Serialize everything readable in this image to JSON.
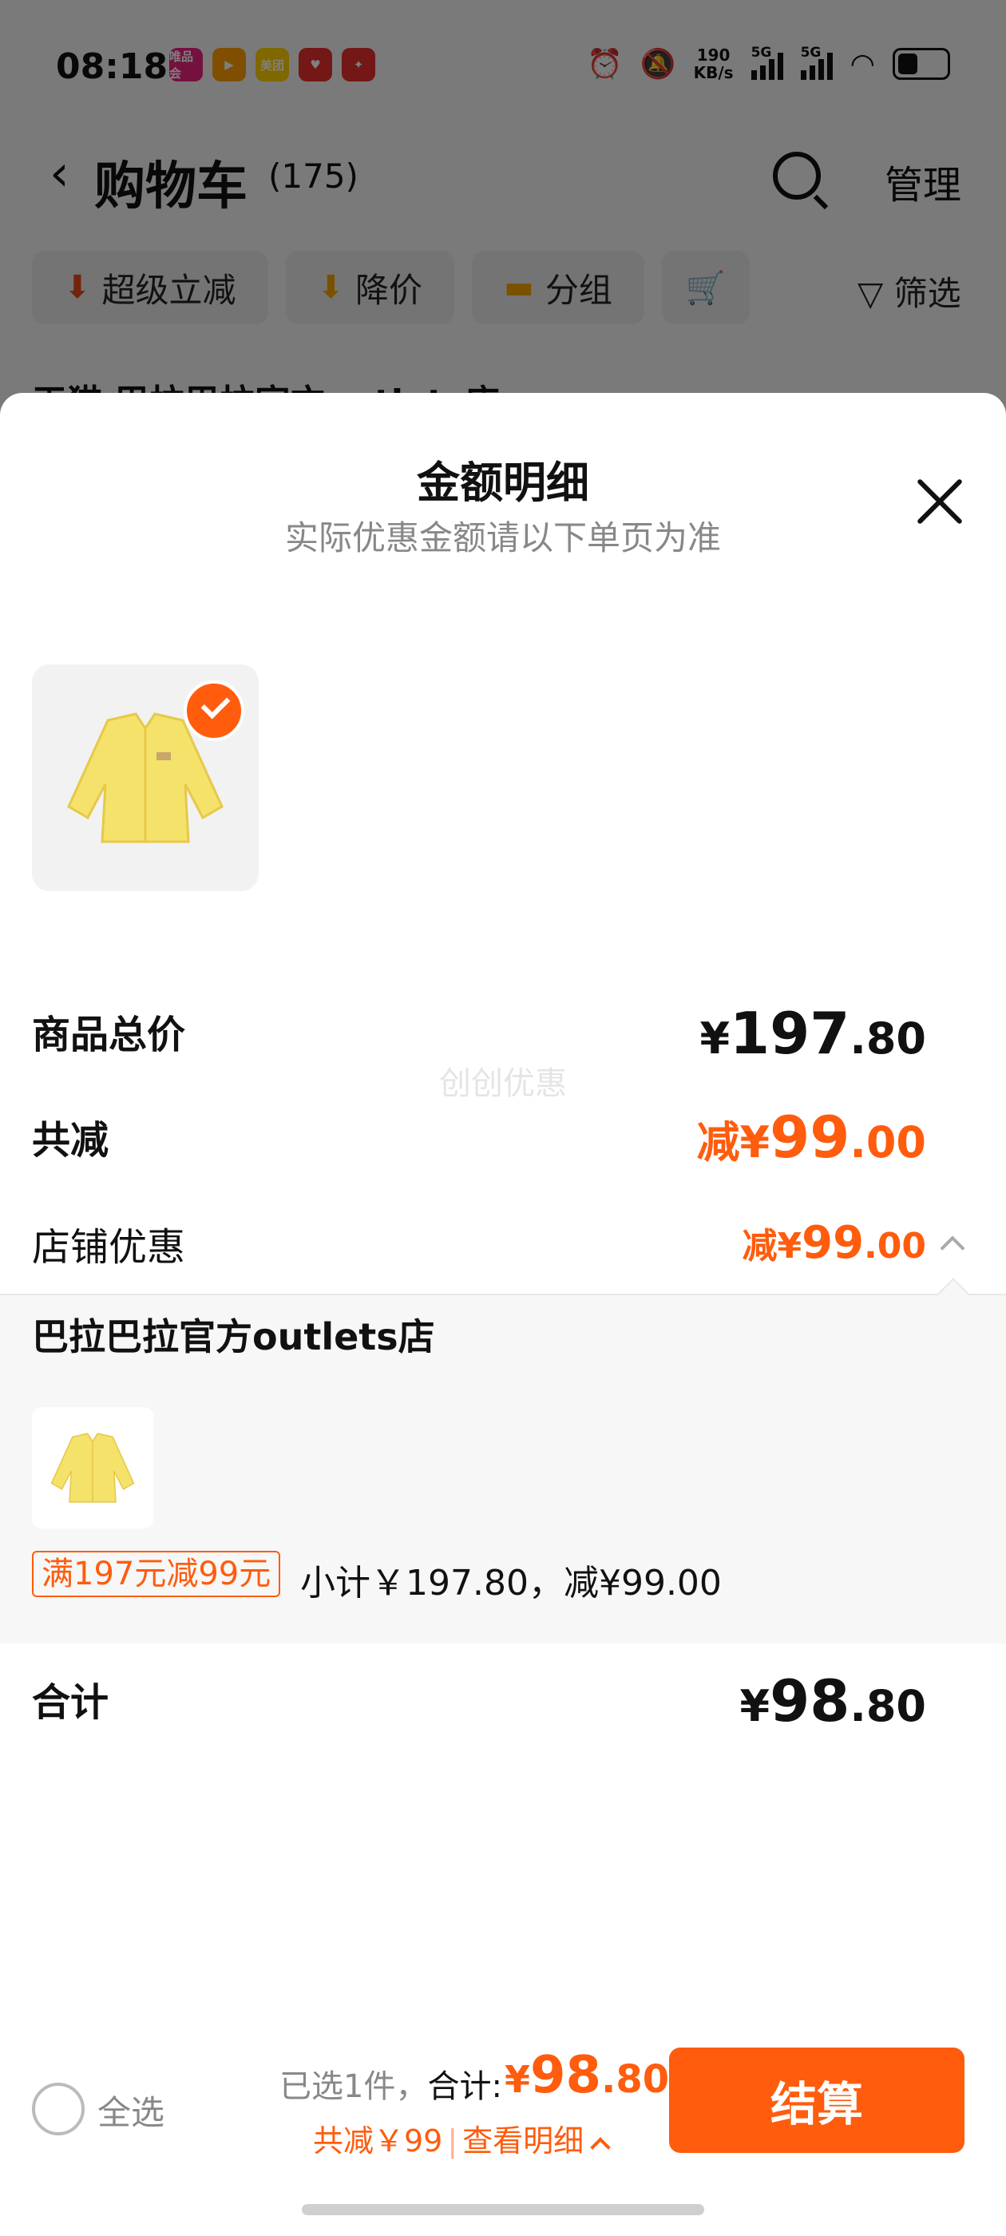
{
  "status_bar": {
    "time": "08:18",
    "net_speed_value": "190",
    "net_speed_unit": "KB/s",
    "signal_1": "5G",
    "signal_2": "5G",
    "apps": [
      {
        "icon": "vipshop-app-icon",
        "color": "#e8237e",
        "label": "唯品会"
      },
      {
        "icon": "video-app-icon",
        "color": "#ff9c00",
        "label": "▶"
      },
      {
        "icon": "meituan-app-icon",
        "color": "#ffd100",
        "label": "美团"
      },
      {
        "icon": "health-app-icon",
        "color": "#e62e2e",
        "label": "♥"
      },
      {
        "icon": "sale-app-icon",
        "color": "#e62e2e",
        "label": "✦"
      }
    ]
  },
  "header": {
    "title": "购物车",
    "count": "(175)",
    "manage_label": "管理"
  },
  "filters": [
    {
      "label": "超级立减",
      "icon": "arrow-down-icon"
    },
    {
      "label": "降价",
      "icon": "price-drop-icon"
    },
    {
      "label": "分组",
      "icon": "folder-icon"
    },
    {
      "label": "",
      "icon": "cart-icon"
    }
  ],
  "filter_button_label": "筛选",
  "shop_peek": "天猫 巴拉巴拉官方outlets店",
  "sheet": {
    "title": "金额明细",
    "subtitle": "实际优惠金额请以下单页为准",
    "watermark": "创创优惠",
    "total_price": {
      "label": "商品总价",
      "currency": "¥",
      "integer": "197",
      "decimal": ".80"
    },
    "discount": {
      "label": "共减",
      "prefix": "减¥",
      "integer": "99",
      "decimal": ".00"
    },
    "shop_discount": {
      "label": "店铺优惠",
      "prefix": "减¥",
      "integer": "99",
      "decimal": ".00"
    },
    "shop_detail": {
      "shop_name": "巴拉巴拉官方outlets店",
      "promo_tag": "满197元减99元",
      "promo_summary": "小计￥197.80，减¥99.00"
    },
    "sum": {
      "label": "合计",
      "currency": "¥",
      "integer": "98",
      "decimal": ".80"
    }
  },
  "checkout": {
    "select_all": "全选",
    "picked_prefix": "已选1件，",
    "picked_total_label": "合计:",
    "currency": "¥",
    "integer": "98",
    "decimal": ".80",
    "save_text": "共减￥99",
    "separator": "|",
    "view_detail": "查看明细",
    "button_label": "结算"
  },
  "colors": {
    "accent": "#ff5c0d",
    "product": "#f5e26b"
  }
}
